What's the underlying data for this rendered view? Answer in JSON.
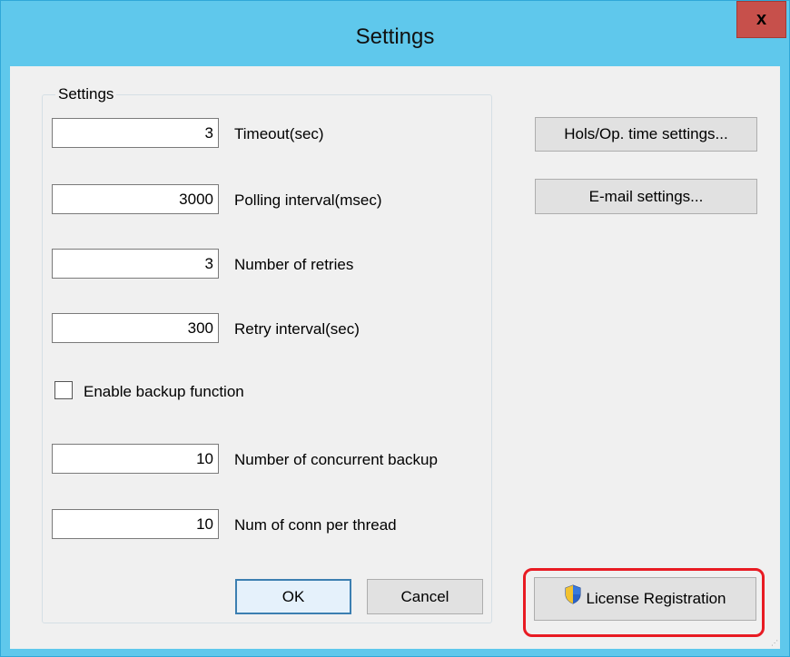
{
  "window": {
    "title": "Settings",
    "close_label": "x"
  },
  "group": {
    "label": "Settings"
  },
  "fields": [
    {
      "value": "3",
      "label": "Timeout(sec)"
    },
    {
      "value": "3000",
      "label": "Polling interval(msec)"
    },
    {
      "value": "3",
      "label": "Number of retries"
    },
    {
      "value": "300",
      "label": "Retry interval(sec)"
    },
    {
      "value": "10",
      "label": "Number of concurrent backup"
    },
    {
      "value": "10",
      "label": "Num of conn per thread"
    }
  ],
  "backup": {
    "label": "Enable backup function",
    "checked": false
  },
  "buttons": {
    "hols": "Hols/Op. time settings...",
    "email": "E-mail settings...",
    "ok": "OK",
    "cancel": "Cancel",
    "license": "License Registration"
  },
  "colors": {
    "titlebar": "#5fc8ec",
    "close": "#c7504b",
    "highlight": "#e81b23"
  }
}
